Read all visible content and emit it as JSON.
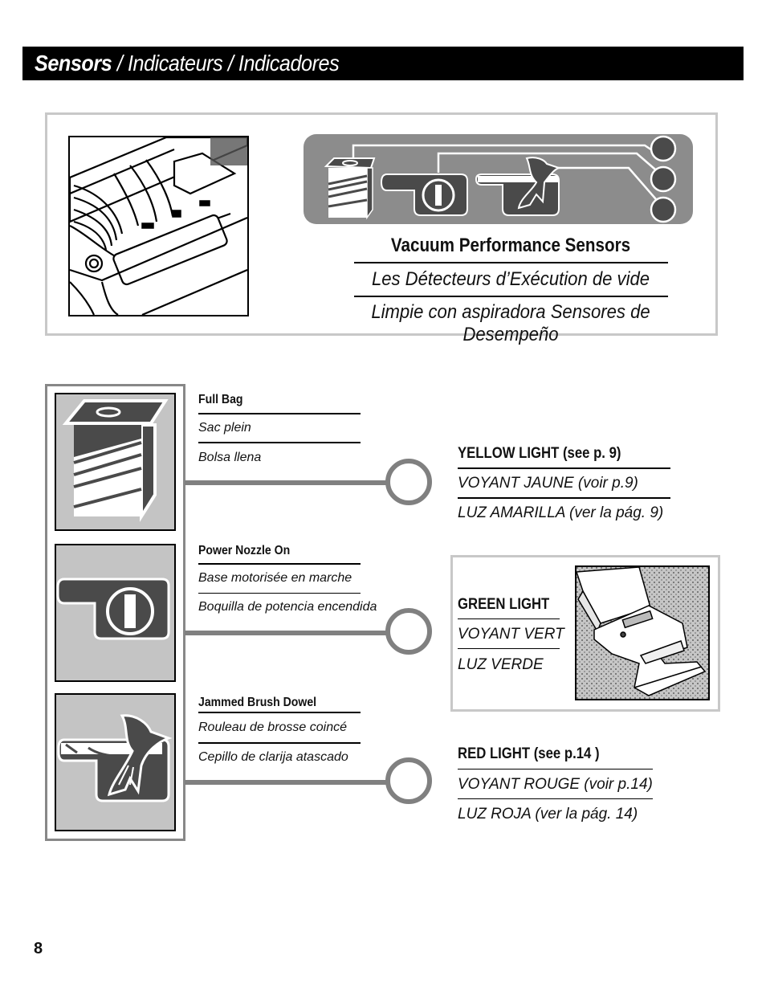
{
  "header": {
    "title_bold": "Sensors",
    "title_rest": " / Indicateurs / Indicadores"
  },
  "intro": {
    "heading_en": "Vacuum Performance Sensors",
    "heading_fr": "Les Détecteurs d’Exécution de vide",
    "heading_es": "Limpie con aspiradora Sensores de Desempeño",
    "panel_icons": [
      "full-bag-icon",
      "power-nozzle-icon",
      "jammed-brush-icon"
    ],
    "panel_lights": 3
  },
  "sensors": [
    {
      "icon": "full-bag-icon",
      "en": "Full Bag",
      "fr": "Sac plein",
      "es": "Bolsa llena"
    },
    {
      "icon": "power-nozzle-icon",
      "en": "Power Nozzle On",
      "fr": "Base motorisée en marche",
      "es": "Boquilla de potencia encendida"
    },
    {
      "icon": "jammed-brush-icon",
      "en": "Jammed Brush Dowel",
      "fr": "Rouleau de brosse coincé",
      "es": "Cepillo de clarija atascado"
    }
  ],
  "lights": [
    {
      "en": "YELLOW LIGHT (see p. 9)",
      "fr": "VOYANT JAUNE (voir p.9)",
      "es": "LUZ AMARILLA (ver la pág. 9)"
    },
    {
      "en": "GREEN LIGHT",
      "fr": "VOYANT VERT",
      "es": "LUZ VERDE"
    },
    {
      "en": "RED LIGHT (see p.14 )",
      "fr": "VOYANT ROUGE (voir p.14)",
      "es": "LUZ ROJA (ver la pág. 14)"
    }
  ],
  "colors": {
    "header_bg": "#000000",
    "panel_gray": "#8c8c8c",
    "icon_dark": "#4a4a4a",
    "tile_gray": "#c4c4c4",
    "connector_gray": "#808080"
  },
  "footer": {
    "page_number": "8"
  }
}
